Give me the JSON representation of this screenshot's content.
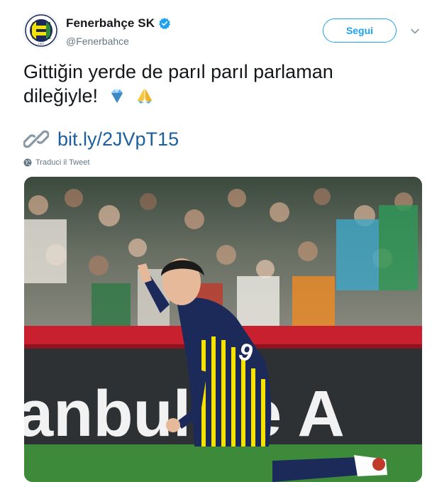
{
  "account": {
    "display_name": "Fenerbahçe SK",
    "handle": "@Fenerbahce",
    "verified": true,
    "logo_year": "1907"
  },
  "actions": {
    "follow_label": "Segui"
  },
  "tweet": {
    "text_line1": "Gittiğin yerde de parıl parıl parlaman",
    "text_line2": "dileğiyle!",
    "emojis": [
      "gem-stone",
      "folded-hands"
    ],
    "link": "bit.ly/2JVpT15",
    "translate_label": "Traduci il Tweet"
  },
  "photo": {
    "banner_text": "anbul ve A"
  },
  "colors": {
    "accent": "#1da1f2",
    "link": "#1b5f9e",
    "club_navy": "#1c2a5a",
    "club_yellow": "#f5e200"
  }
}
